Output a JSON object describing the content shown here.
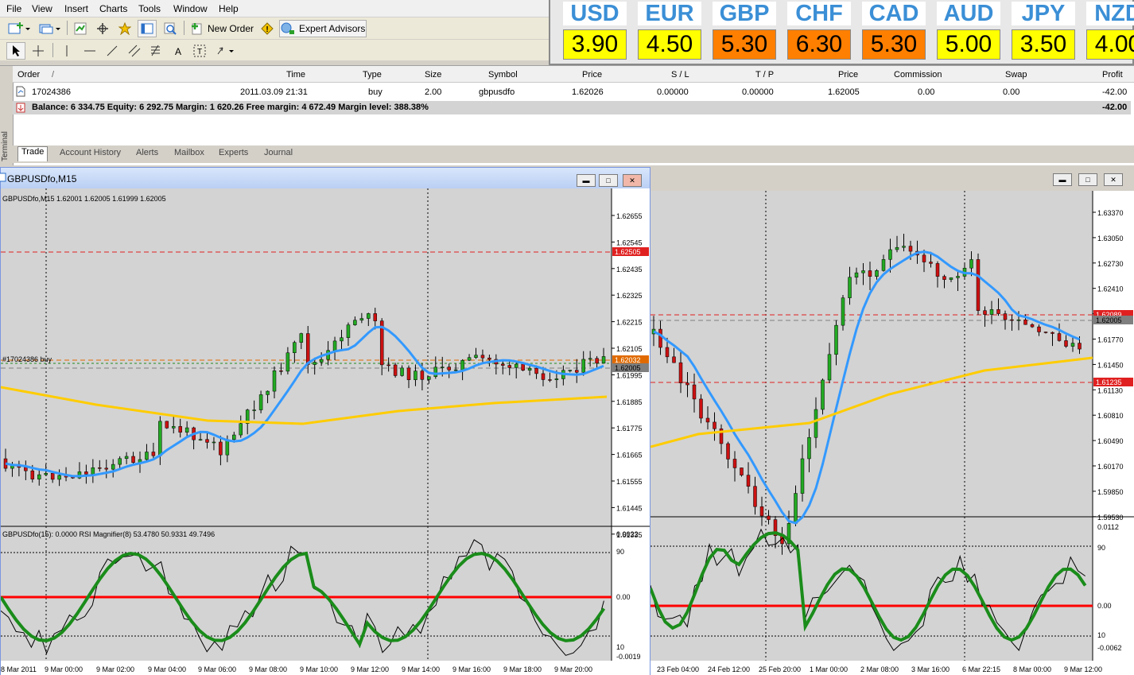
{
  "menu": [
    "File",
    "View",
    "Insert",
    "Charts",
    "Tools",
    "Window",
    "Help"
  ],
  "toolbar": {
    "new_order": "New Order",
    "expert_advisors": "Expert Advisors"
  },
  "quotes": {
    "codes": [
      "USD",
      "EUR",
      "GBP",
      "CHF",
      "CAD",
      "AUD",
      "JPY",
      "NZD"
    ],
    "values": [
      "3.90",
      "4.50",
      "5.30",
      "6.30",
      "5.30",
      "5.00",
      "3.50",
      "4.00"
    ],
    "colors": [
      "#ffff00",
      "#ffff00",
      "#ff7f00",
      "#ff7f00",
      "#ff7f00",
      "#ffff00",
      "#ffff00",
      "#ffff00"
    ]
  },
  "terminal": {
    "side_label": "Terminal",
    "headers": {
      "order": "Order",
      "sort_mark": "/",
      "time": "Time",
      "type": "Type",
      "size": "Size",
      "symbol": "Symbol",
      "price": "Price",
      "sl": "S / L",
      "tp": "T / P",
      "price2": "Price",
      "commission": "Commission",
      "swap": "Swap",
      "profit": "Profit"
    },
    "row": {
      "order": "17024386",
      "time": "2011.03.09 21:31",
      "type": "buy",
      "size": "2.00",
      "symbol": "gbpusdfo",
      "price": "1.62026",
      "sl": "0.00000",
      "tp": "0.00000",
      "price2": "1.62005",
      "commission": "0.00",
      "swap": "0.00",
      "profit": "-42.00"
    },
    "balance": "Balance: 6 334.75  Equity: 6 292.75  Margin: 1 620.26  Free margin: 4 672.49  Margin level: 388.38%",
    "balance_profit": "-42.00",
    "tabs": [
      "Trade",
      "Account History",
      "Alerts",
      "Mailbox",
      "Experts",
      "Journal"
    ]
  },
  "chart1": {
    "title": "GBPUSDfo,M15",
    "info": "GBPUSDfo,M15  1.62001 1.62005 1.61999 1.62005",
    "order_label": "#17024386 buy",
    "price_ticks": [
      "1.62655",
      "1.62545",
      "1.62435",
      "1.62325",
      "1.62215",
      "1.62105",
      "1.61995",
      "1.61885",
      "1.61775",
      "1.61665",
      "1.61555",
      "1.61445",
      "1.61335"
    ],
    "markers": {
      "red": "1.62505",
      "orange": "1.62032",
      "black": "1.62005"
    },
    "indicator_info": "GBPUSDfo(15):  0.0000  RSI Magnifier(8) 53.4780 50.9331 49.7496",
    "ind_ticks": [
      "0.0022",
      "90",
      "0.00",
      "10",
      "-0.0019"
    ],
    "time_ticks": [
      "8 Mar 2011",
      "9 Mar 00:00",
      "9 Mar 02:00",
      "9 Mar 04:00",
      "9 Mar 06:00",
      "9 Mar 08:00",
      "9 Mar 10:00",
      "9 Mar 12:00",
      "9 Mar 14:00",
      "9 Mar 16:00",
      "9 Mar 18:00",
      "9 Mar 20:00"
    ]
  },
  "chart2": {
    "price_ticks": [
      "1.63370",
      "1.63050",
      "1.62730",
      "1.62410",
      "1.62090",
      "1.61770",
      "1.61450",
      "1.61130",
      "1.60810",
      "1.60490",
      "1.60170",
      "1.59850",
      "1.59530"
    ],
    "markers": {
      "red1": "1.62089",
      "black": "1.62005",
      "red2": "1.61235"
    },
    "ind_ticks": [
      "0.0112",
      "90",
      "0.00",
      "10",
      "-0.0062"
    ],
    "time_ticks": [
      "23 Feb 04:00",
      "24 Feb 12:00",
      "25 Feb 20:00",
      "1 Mar 00:00",
      "2 Mar 08:00",
      "3 Mar 16:00",
      "6 Mar 22:15",
      "8 Mar 00:00",
      "9 Mar 12:00"
    ]
  },
  "colors": {
    "accent": "#3399ff",
    "ma": "#ffcc00",
    "rsi": "#1a8c1a",
    "zero": "#ff0000",
    "bull": "#22aa22",
    "bear": "#cc1111"
  }
}
